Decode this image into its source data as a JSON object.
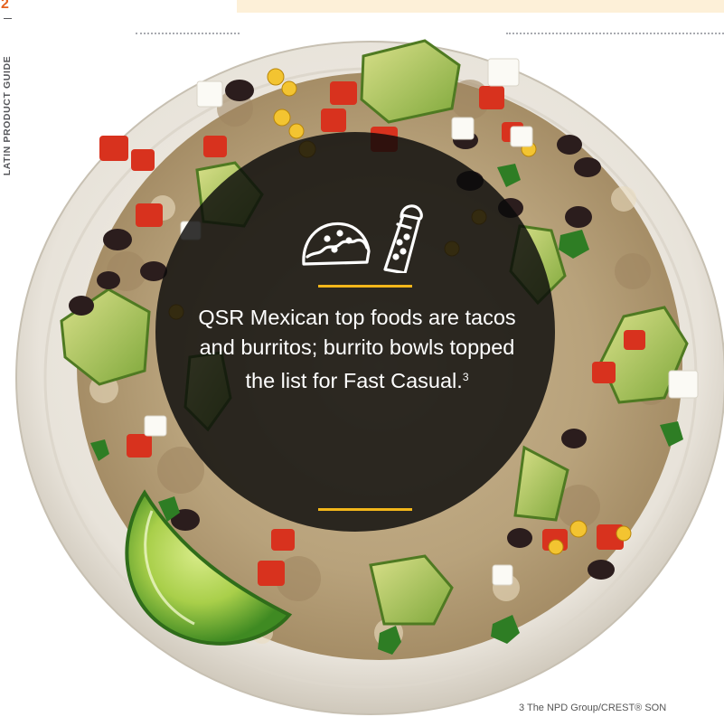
{
  "page": {
    "number": "2",
    "guide_title": "LATIN PRODUCT GUIDE"
  },
  "callout": {
    "text": "QSR Mexican top foods are tacos and burritos; burrito bowls topped the list for Fast Casual.",
    "footnote_ref": "3",
    "icons": [
      "taco-icon",
      "burrito-icon"
    ]
  },
  "footnote": {
    "text": "3 The NPD Group/CREST® SON"
  },
  "colors": {
    "accent_orange": "#e5611e",
    "gold": "#f2b61a",
    "overlay": "#0a0a0a",
    "plate": "#ece8e0"
  }
}
